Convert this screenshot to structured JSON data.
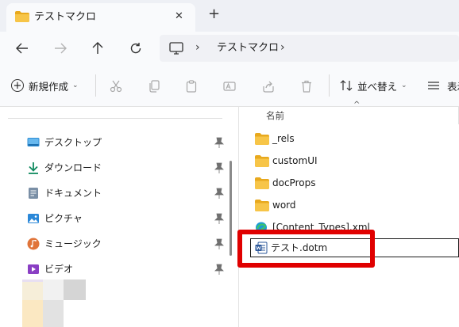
{
  "tab": {
    "title": "テストマクロ",
    "close": "✕",
    "new_tab": "+"
  },
  "address": {
    "crumb": "テストマクロ",
    "chevron": "›"
  },
  "toolbar": {
    "new_label": "新規作成",
    "new_plus": "+",
    "caret": "⌄",
    "sort_label": "並べ替え",
    "view_label": "表示"
  },
  "nav_items": [
    {
      "label": "デスクトップ",
      "icon": "desktop-icon"
    },
    {
      "label": "ダウンロード",
      "icon": "download-icon"
    },
    {
      "label": "ドキュメント",
      "icon": "document-icon"
    },
    {
      "label": "ピクチャ",
      "icon": "pictures-icon"
    },
    {
      "label": "ミュージック",
      "icon": "music-icon"
    },
    {
      "label": "ビデオ",
      "icon": "videos-icon"
    }
  ],
  "file_list": {
    "column_name": "名前",
    "sort_arrow": "^",
    "items": [
      {
        "label": "_rels",
        "icon": "folder-icon"
      },
      {
        "label": "customUI",
        "icon": "folder-icon"
      },
      {
        "label": "docProps",
        "icon": "folder-icon"
      },
      {
        "label": "word",
        "icon": "folder-icon"
      },
      {
        "label": "[Content_Types].xml",
        "icon": "edge-xml-icon"
      },
      {
        "label": "テスト.dotm",
        "icon": "word-doc-icon"
      }
    ]
  },
  "colors": {
    "highlight": "#e00000",
    "folder": "#f5c242",
    "word": "#2b579a",
    "accent": "#0067c0"
  }
}
